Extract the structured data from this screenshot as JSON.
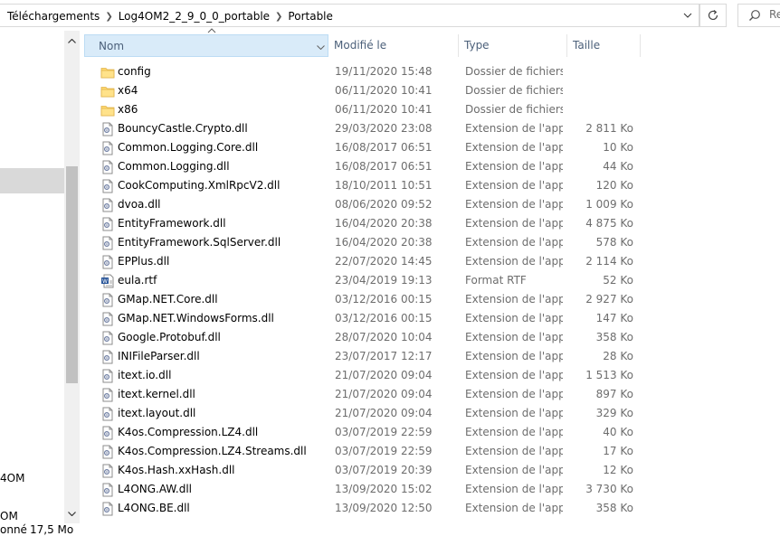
{
  "breadcrumb": [
    "Téléchargements",
    "Log4OM2_2_9_0_0_portable",
    "Portable"
  ],
  "search": {
    "placeholder": "Rechercher dans : Portable"
  },
  "nav": {
    "item1": "4OM",
    "item2": "OM"
  },
  "status": {
    "count": "onné",
    "size": "17,5 Mo"
  },
  "columns": {
    "name": "Nom",
    "modified": "Modifié le",
    "type": "Type",
    "size": "Taille"
  },
  "files": [
    {
      "icon": "folder-icon",
      "name": "config",
      "modified": "19/11/2020 15:48",
      "type": "Dossier de fichiers",
      "size": ""
    },
    {
      "icon": "folder-icon",
      "name": "x64",
      "modified": "06/11/2020 10:41",
      "type": "Dossier de fichiers",
      "size": ""
    },
    {
      "icon": "folder-icon",
      "name": "x86",
      "modified": "06/11/2020 10:41",
      "type": "Dossier de fichiers",
      "size": ""
    },
    {
      "icon": "dll-file-icon",
      "name": "BouncyCastle.Crypto.dll",
      "modified": "29/03/2020 23:08",
      "type": "Extension de l'application",
      "size": "2 811 Ko"
    },
    {
      "icon": "dll-file-icon",
      "name": "Common.Logging.Core.dll",
      "modified": "16/08/2017 06:51",
      "type": "Extension de l'application",
      "size": "10 Ko"
    },
    {
      "icon": "dll-file-icon",
      "name": "Common.Logging.dll",
      "modified": "16/08/2017 06:51",
      "type": "Extension de l'application",
      "size": "44 Ko"
    },
    {
      "icon": "dll-file-icon",
      "name": "CookComputing.XmlRpcV2.dll",
      "modified": "18/10/2011 10:51",
      "type": "Extension de l'application",
      "size": "120 Ko"
    },
    {
      "icon": "dll-file-icon",
      "name": "dvoa.dll",
      "modified": "08/06/2020 09:52",
      "type": "Extension de l'application",
      "size": "1 009 Ko"
    },
    {
      "icon": "dll-file-icon",
      "name": "EntityFramework.dll",
      "modified": "16/04/2020 20:38",
      "type": "Extension de l'application",
      "size": "4 875 Ko"
    },
    {
      "icon": "dll-file-icon",
      "name": "EntityFramework.SqlServer.dll",
      "modified": "16/04/2020 20:38",
      "type": "Extension de l'application",
      "size": "578 Ko"
    },
    {
      "icon": "dll-file-icon",
      "name": "EPPlus.dll",
      "modified": "22/07/2020 14:45",
      "type": "Extension de l'application",
      "size": "2 114 Ko"
    },
    {
      "icon": "rtf-file-icon",
      "name": "eula.rtf",
      "modified": "23/04/2019 19:13",
      "type": "Format RTF",
      "size": "52 Ko"
    },
    {
      "icon": "dll-file-icon",
      "name": "GMap.NET.Core.dll",
      "modified": "03/12/2016 00:15",
      "type": "Extension de l'application",
      "size": "2 927 Ko"
    },
    {
      "icon": "dll-file-icon",
      "name": "GMap.NET.WindowsForms.dll",
      "modified": "03/12/2016 00:15",
      "type": "Extension de l'application",
      "size": "147 Ko"
    },
    {
      "icon": "dll-file-icon",
      "name": "Google.Protobuf.dll",
      "modified": "28/07/2020 10:04",
      "type": "Extension de l'application",
      "size": "358 Ko"
    },
    {
      "icon": "dll-file-icon",
      "name": "INIFileParser.dll",
      "modified": "23/07/2017 12:17",
      "type": "Extension de l'application",
      "size": "28 Ko"
    },
    {
      "icon": "dll-file-icon",
      "name": "itext.io.dll",
      "modified": "21/07/2020 09:04",
      "type": "Extension de l'application",
      "size": "1 513 Ko"
    },
    {
      "icon": "dll-file-icon",
      "name": "itext.kernel.dll",
      "modified": "21/07/2020 09:04",
      "type": "Extension de l'application",
      "size": "897 Ko"
    },
    {
      "icon": "dll-file-icon",
      "name": "itext.layout.dll",
      "modified": "21/07/2020 09:04",
      "type": "Extension de l'application",
      "size": "329 Ko"
    },
    {
      "icon": "dll-file-icon",
      "name": "K4os.Compression.LZ4.dll",
      "modified": "03/07/2019 22:59",
      "type": "Extension de l'application",
      "size": "40 Ko"
    },
    {
      "icon": "dll-file-icon",
      "name": "K4os.Compression.LZ4.Streams.dll",
      "modified": "03/07/2019 22:59",
      "type": "Extension de l'application",
      "size": "17 Ko"
    },
    {
      "icon": "dll-file-icon",
      "name": "K4os.Hash.xxHash.dll",
      "modified": "03/07/2019 20:39",
      "type": "Extension de l'application",
      "size": "12 Ko"
    },
    {
      "icon": "dll-file-icon",
      "name": "L4ONG.AW.dll",
      "modified": "13/09/2020 15:02",
      "type": "Extension de l'application",
      "size": "3 730 Ko"
    },
    {
      "icon": "dll-file-icon",
      "name": "L4ONG.BE.dll",
      "modified": "13/09/2020 12:50",
      "type": "Extension de l'application",
      "size": "358 Ko"
    }
  ]
}
